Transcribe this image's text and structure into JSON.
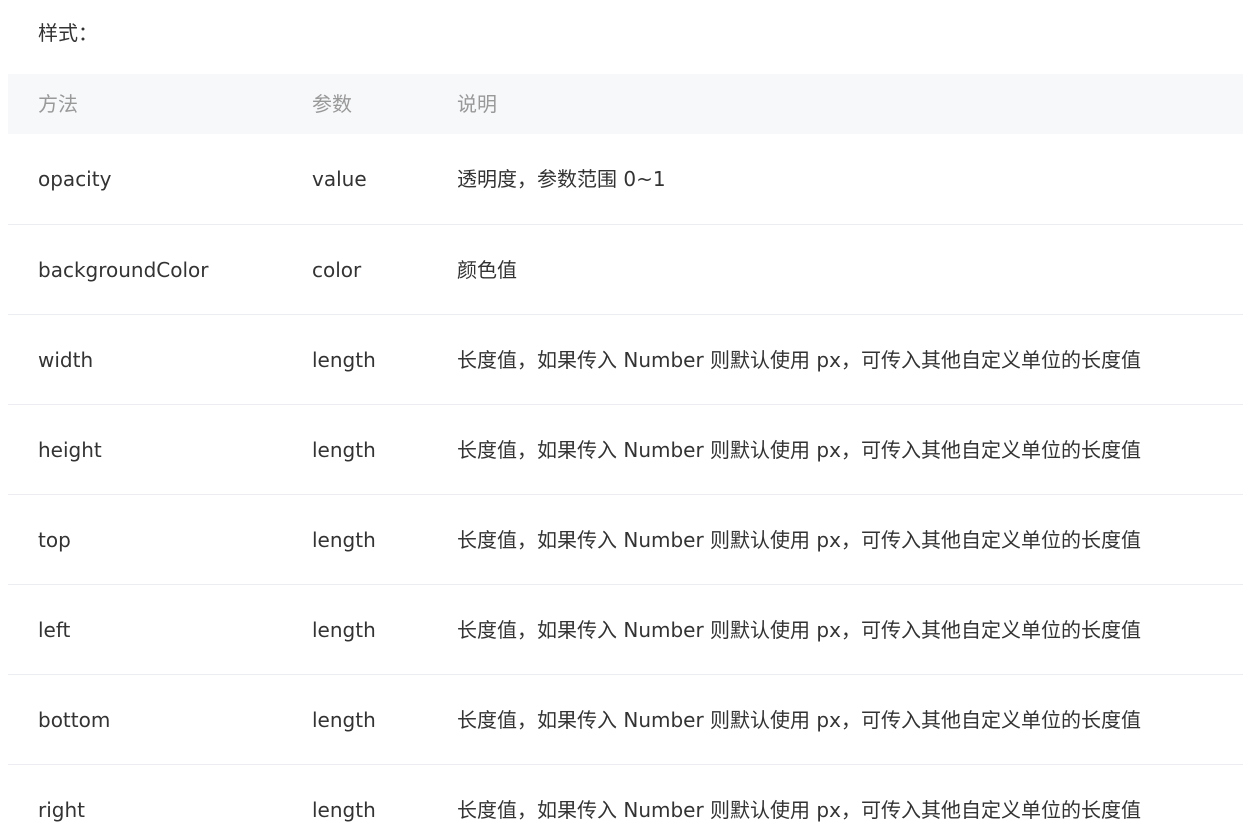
{
  "section_label": "样式：",
  "table": {
    "headers": [
      "方法",
      "参数",
      "说明"
    ],
    "rows": [
      [
        "opacity",
        "value",
        "透明度，参数范围 0~1"
      ],
      [
        "backgroundColor",
        "color",
        "颜色值"
      ],
      [
        "width",
        "length",
        "长度值，如果传入 Number 则默认使用 px，可传入其他自定义单位的长度值"
      ],
      [
        "height",
        "length",
        "长度值，如果传入 Number 则默认使用 px，可传入其他自定义单位的长度值"
      ],
      [
        "top",
        "length",
        "长度值，如果传入 Number 则默认使用 px，可传入其他自定义单位的长度值"
      ],
      [
        "left",
        "length",
        "长度值，如果传入 Number 则默认使用 px，可传入其他自定义单位的长度值"
      ],
      [
        "bottom",
        "length",
        "长度值，如果传入 Number 则默认使用 px，可传入其他自定义单位的长度值"
      ],
      [
        "right",
        "length",
        "长度值，如果传入 Number 则默认使用 px，可传入其他自定义单位的长度值"
      ]
    ]
  }
}
